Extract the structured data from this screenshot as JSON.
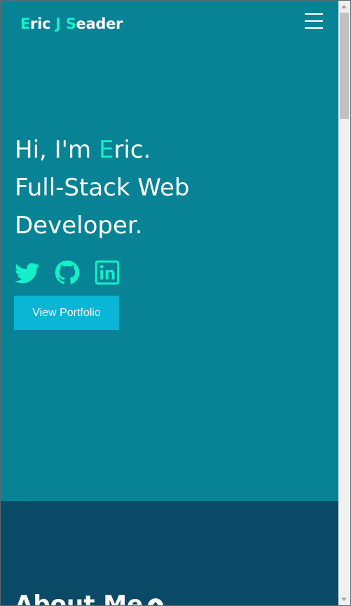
{
  "nav": {
    "brand": {
      "parts": [
        {
          "text": "E",
          "accent": true
        },
        {
          "text": "ric ",
          "accent": false
        },
        {
          "text": "J",
          "accent": true
        },
        {
          "text": " ",
          "accent": false
        },
        {
          "text": "S",
          "accent": true
        },
        {
          "text": "eader",
          "accent": false
        }
      ]
    },
    "menu_icon": "hamburger-menu-icon"
  },
  "hero": {
    "greeting_prefix": "Hi, I'm ",
    "name_initial": "E",
    "name_rest": "ric.",
    "title_line1": "Full-Stack Web",
    "title_line2": "Developer.",
    "socials": [
      {
        "icon": "twitter-icon"
      },
      {
        "icon": "github-icon"
      },
      {
        "icon": "linkedin-icon"
      }
    ],
    "cta_label": "View Portfolio"
  },
  "about": {
    "title": "About Me",
    "icon": "arrow-up-circle-icon"
  },
  "colors": {
    "hero_bg": "#088395",
    "about_bg": "#0a4a66",
    "accent": "#14f0c8",
    "button_bg": "#0ab5d6",
    "text": "#ffffff"
  }
}
